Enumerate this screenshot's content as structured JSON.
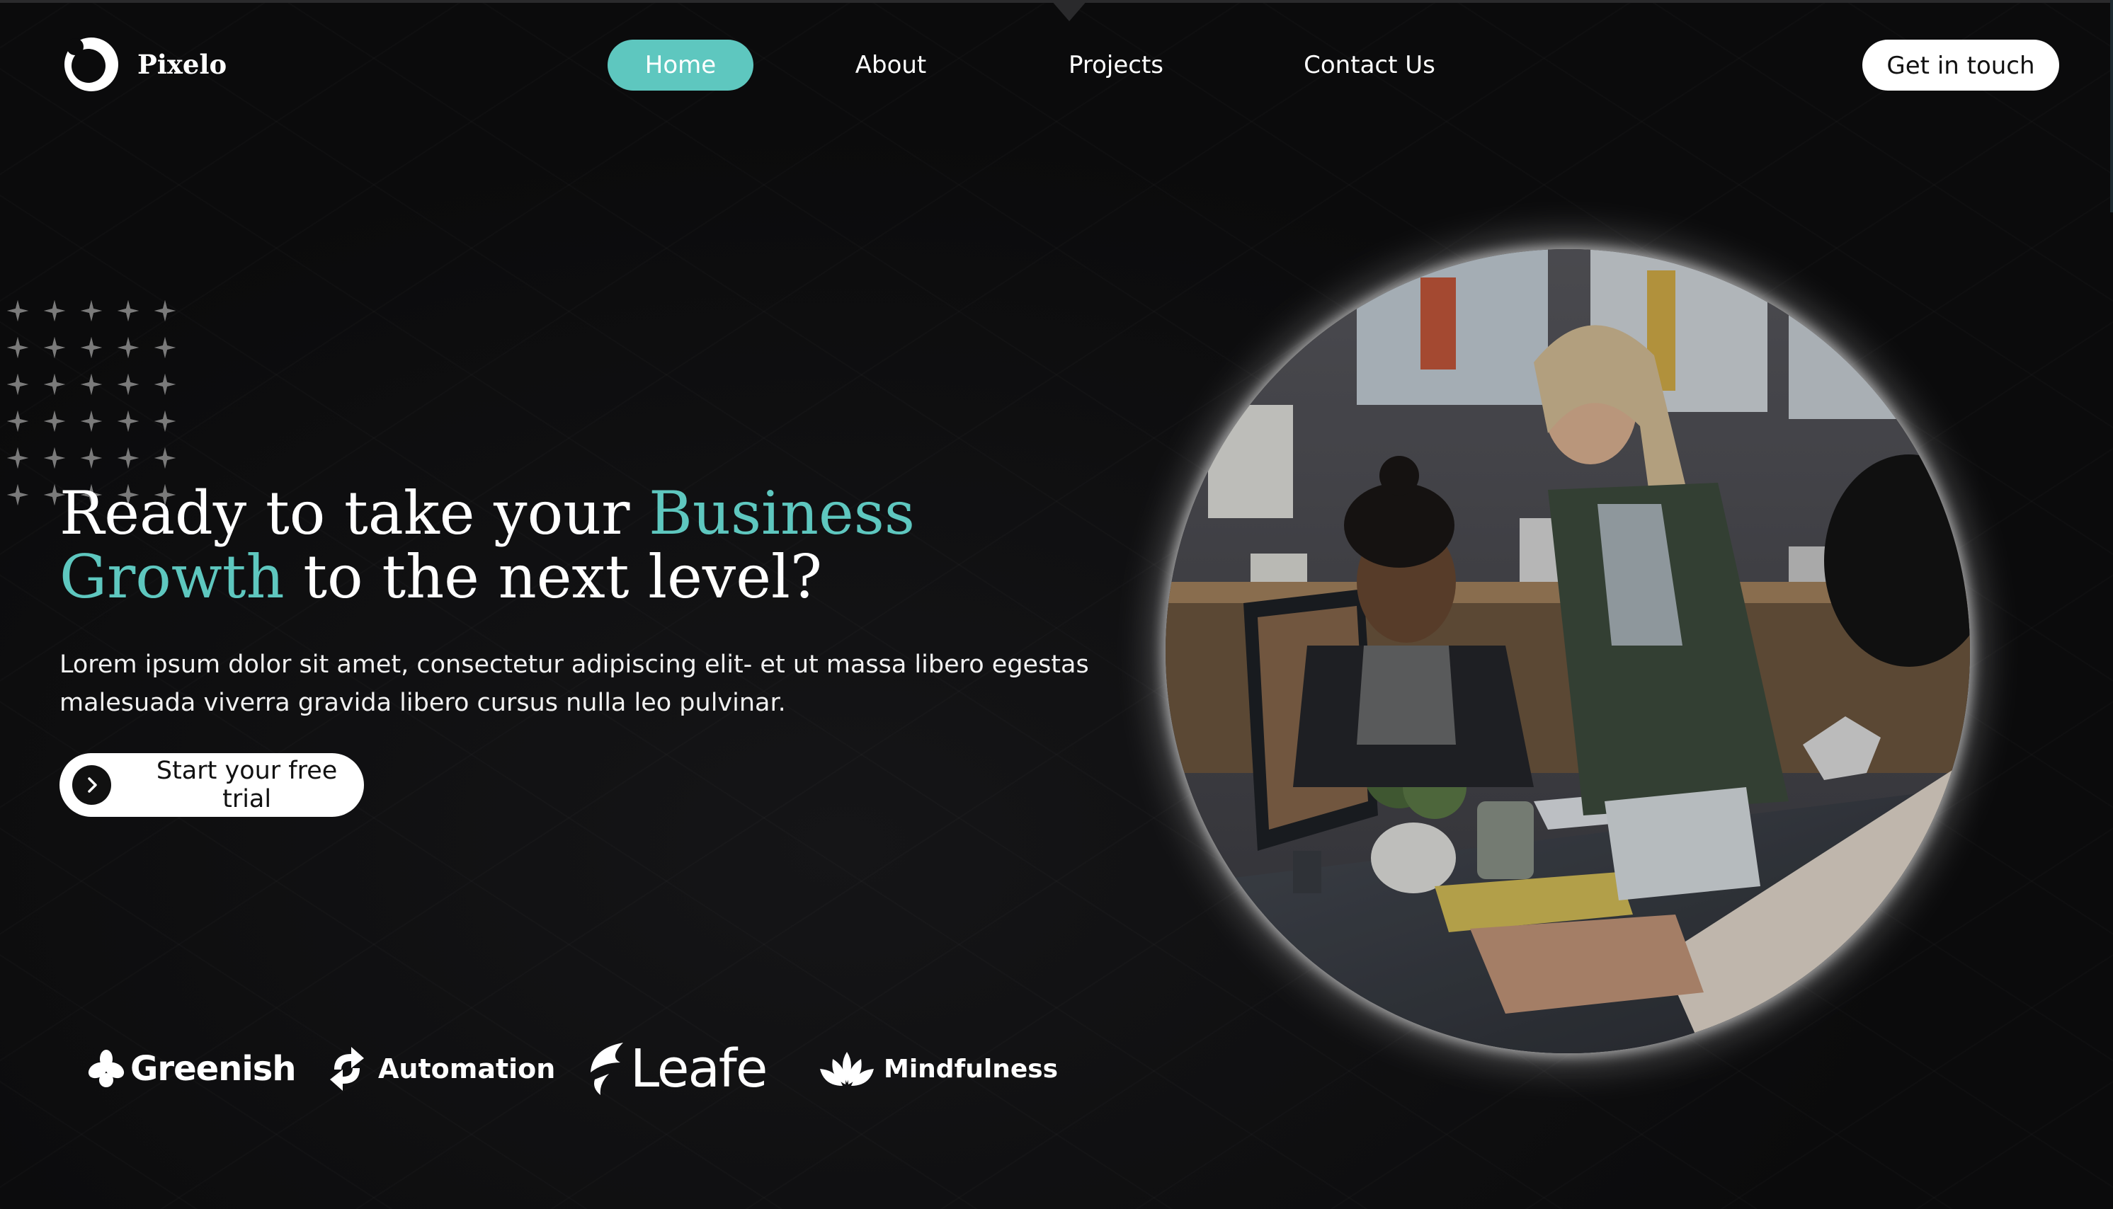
{
  "brand": {
    "name": "Pixelo",
    "logo_icon": "crescent-ring-icon"
  },
  "nav": {
    "items": [
      {
        "label": "Home",
        "active": true
      },
      {
        "label": "About",
        "active": false
      },
      {
        "label": "Projects",
        "active": false
      },
      {
        "label": "Contact Us",
        "active": false
      }
    ],
    "cta_label": "Get in touch"
  },
  "hero": {
    "headline_part1": "Ready to take your ",
    "headline_accent": "Business Growth",
    "headline_part2": " to the next level?",
    "lead": "Lorem ipsum dolor sit amet, consectetur adipiscing elit- et ut massa libero egestas malesuada viverra gravida libero cursus nulla leo pulvinar.",
    "cta_label": "Start your free trial",
    "cta_icon": "chevron-right-icon",
    "image_description_icon": "team-office-photo"
  },
  "partners": [
    {
      "name": "Greenish",
      "icon": "leaf-cluster-icon"
    },
    {
      "name": "Automation",
      "icon": "sync-arrows-icon"
    },
    {
      "name": "Leafe",
      "icon": "leaf-swoosh-icon"
    },
    {
      "name": "Mindfulness",
      "icon": "lotus-icon"
    }
  ],
  "colors": {
    "background": "#0b0b0c",
    "accent": "#5ec7bf",
    "text": "#ffffff",
    "button_bg": "#ffffff"
  }
}
